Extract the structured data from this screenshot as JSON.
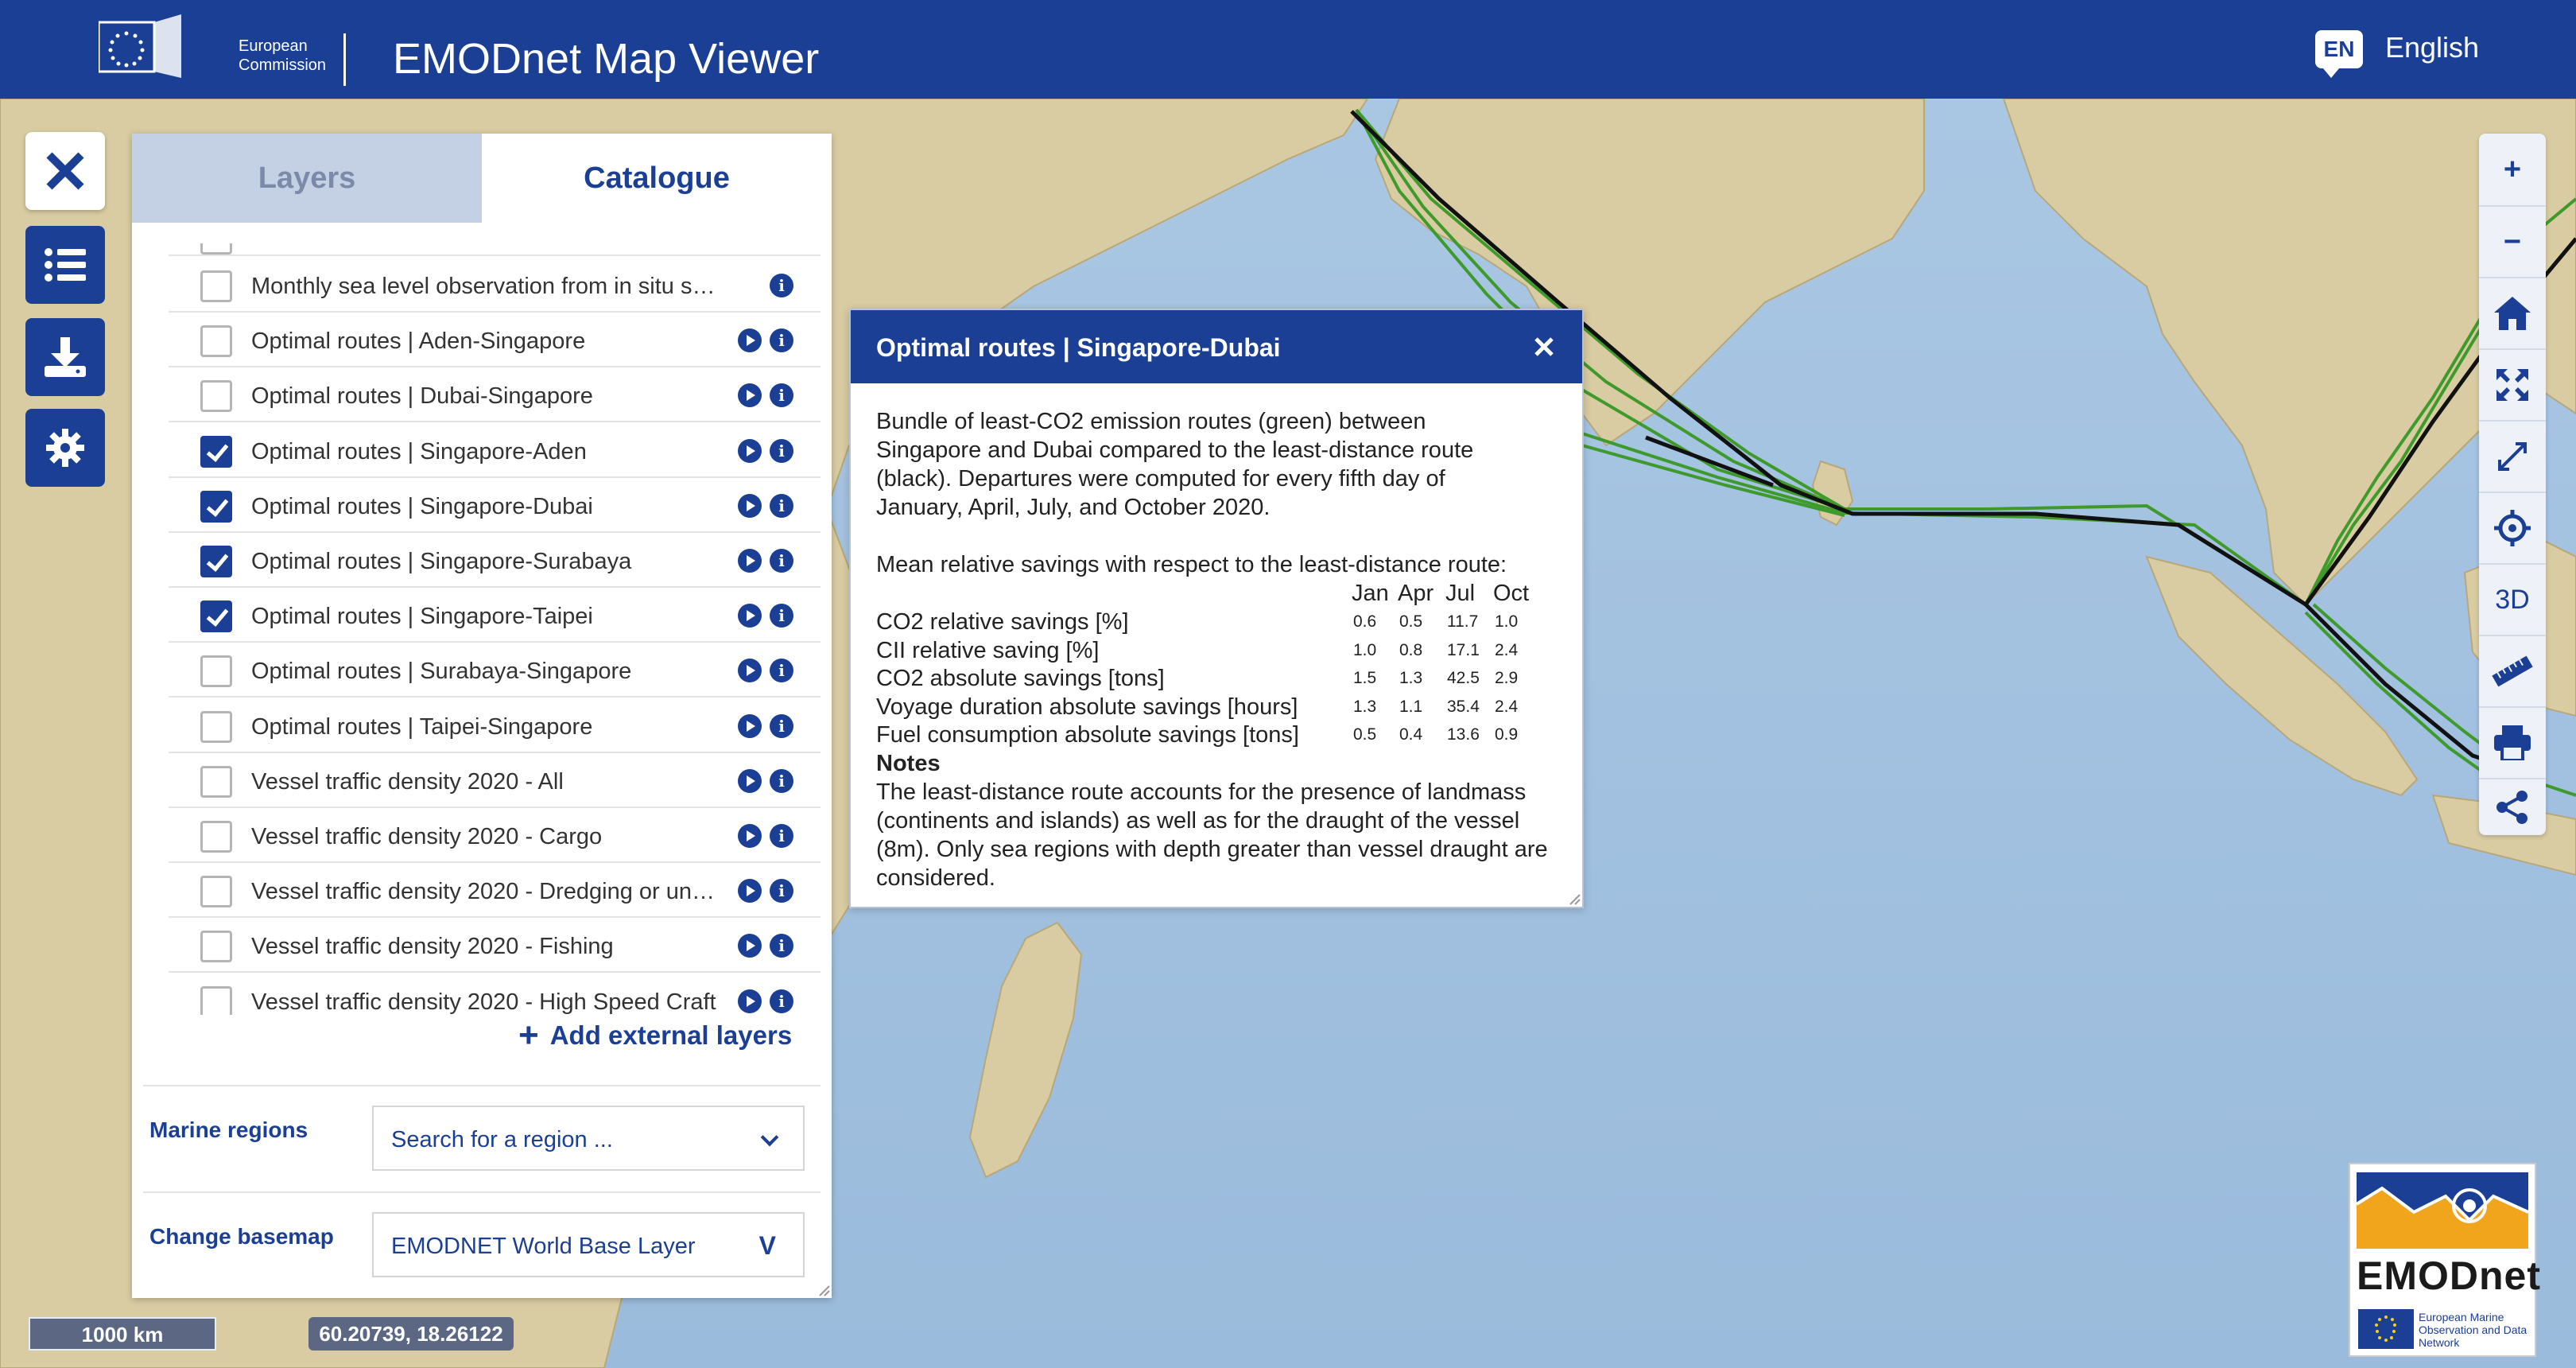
{
  "header": {
    "ec_logo_line1": "European",
    "ec_logo_line2": "Commission",
    "app_title": "EMODnet Map Viewer",
    "language_code": "EN",
    "language_label": "English"
  },
  "tabs": {
    "layers": "Layers",
    "catalogue": "Catalogue"
  },
  "catalogue": {
    "items": [
      {
        "label": "Monthly sea level observation from in situ s…",
        "checked": false,
        "play": false
      },
      {
        "label": "Optimal routes | Aden-Singapore",
        "checked": false,
        "play": true
      },
      {
        "label": "Optimal routes | Dubai-Singapore",
        "checked": false,
        "play": true
      },
      {
        "label": "Optimal routes | Singapore-Aden",
        "checked": true,
        "play": true
      },
      {
        "label": "Optimal routes | Singapore-Dubai",
        "checked": true,
        "play": true
      },
      {
        "label": "Optimal routes | Singapore-Surabaya",
        "checked": true,
        "play": true
      },
      {
        "label": "Optimal routes | Singapore-Taipei",
        "checked": true,
        "play": true
      },
      {
        "label": "Optimal routes | Surabaya-Singapore",
        "checked": false,
        "play": true
      },
      {
        "label": "Optimal routes | Taipei-Singapore",
        "checked": false,
        "play": true
      },
      {
        "label": "Vessel traffic density 2020 - All",
        "checked": false,
        "play": true
      },
      {
        "label": "Vessel traffic density 2020 - Cargo",
        "checked": false,
        "play": true
      },
      {
        "label": "Vessel traffic density 2020 - Dredging or un…",
        "checked": false,
        "play": true
      },
      {
        "label": "Vessel traffic density 2020 - Fishing",
        "checked": false,
        "play": true
      },
      {
        "label": "Vessel traffic density 2020 - High Speed Craft",
        "checked": false,
        "play": true
      }
    ],
    "info_glyph": "i",
    "add_external_label": "Add external layers",
    "add_external_plus": "+"
  },
  "marine_regions": {
    "label": "Marine regions",
    "placeholder": "Search for a region ..."
  },
  "basemap": {
    "label": "Change basemap",
    "value": "EMODNET World Base Layer",
    "chevron": "V"
  },
  "popup": {
    "title": "Optimal routes | Singapore-Dubai",
    "description": "Bundle of least-CO2 emission routes (green) between Singapore and Dubai compared to the least-distance route (black). Departures were computed for every fifth day of January, April, July, and October 2020.",
    "savings_intro": "Mean relative savings with respect to the least-distance route:",
    "columns": [
      "Jan",
      "Apr",
      "Jul",
      "Oct"
    ],
    "rows": [
      {
        "label": "CO2 relative savings [%]",
        "values": [
          "0.6",
          "0.5",
          "11.7",
          "1.0"
        ]
      },
      {
        "label": "CII relative saving [%]",
        "values": [
          "1.0",
          "0.8",
          "17.1",
          "2.4"
        ]
      },
      {
        "label": "CO2 absolute savings [tons]",
        "values": [
          "1.5",
          "1.3",
          "42.5",
          "2.9"
        ]
      },
      {
        "label": "Voyage duration absolute savings [hours]",
        "values": [
          "1.3",
          "1.1",
          "35.4",
          "2.4"
        ]
      },
      {
        "label": "Fuel consumption absolute savings [tons]",
        "values": [
          "0.5",
          "0.4",
          "13.6",
          "0.9"
        ]
      }
    ],
    "notes_title": "Notes",
    "notes_text": "The least-distance route accounts for the presence of landmass (continents and islands) as well as for the draught of the vessel (8m). Only sea regions with depth greater than vessel draught are considered."
  },
  "right_toolbar": {
    "zoom_in": "+",
    "zoom_out": "−",
    "three_d": "3D"
  },
  "status": {
    "scale": "1000 km",
    "coordinates": "60.20739, 18.26122"
  },
  "emodnet_logo": {
    "wordmark": "EMODnet",
    "tagline": "European Marine Observation and Data Network"
  },
  "colors": {
    "brand_blue": "#1b3f94",
    "route_green": "#3f9a2c",
    "route_black": "#111111",
    "land": "#d8cba0",
    "sea_deep": "#a9c6e2"
  }
}
